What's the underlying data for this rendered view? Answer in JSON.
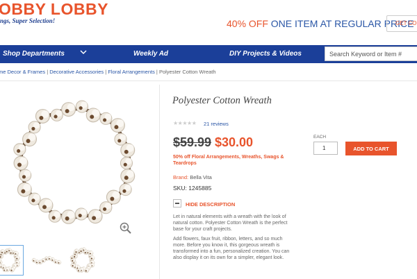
{
  "header": {
    "logo": "OBBY LOBBY",
    "tagline": "ngs, Super Selection!",
    "promo_percent": "40% OFF",
    "promo_rest": " ONE ITEM AT REGULAR PRICE",
    "coupon_label": "GET COU",
    "brand_color": "#e8542c"
  },
  "nav": {
    "items": [
      "Shop Departments",
      "Weekly Ad",
      "DIY Projects & Videos"
    ],
    "search_placeholder": "Search Keyword or Item #"
  },
  "breadcrumb": [
    "me Decor & Frames",
    "Decorative Accessories",
    "Floral Arrangements"
  ],
  "breadcrumb_current": "Polyester Cotton Wreath",
  "product": {
    "title": "Polyester Cotton Wreath",
    "stars": "★★★★★",
    "reviews": "21 reviews",
    "old_price": "$59.99",
    "price": "$30.00",
    "promo_note": "50% off Floral Arrangements, Wreaths, Swags & Teardrops",
    "brand_label": "Brand:",
    "brand": "Bella Vita",
    "sku_label": "SKU:",
    "sku": "1245885",
    "hide_description": "HIDE DESCRIPTION",
    "description": [
      "Let in natural elements with a wreath with the look of natural cotton. Polyester Cotton Wreath is the perfect base for your craft projects.",
      "Add flowers, faux fruit, ribbon, letters, and so much more. Before you know it, this gorgeous wreath is transformed into a fun, personalized creation. You can also display it on its own for a simpler, elegant look."
    ]
  },
  "purchase": {
    "each_label": "EACH",
    "quantity": "1",
    "add_to_cart": "ADD TO CART"
  }
}
